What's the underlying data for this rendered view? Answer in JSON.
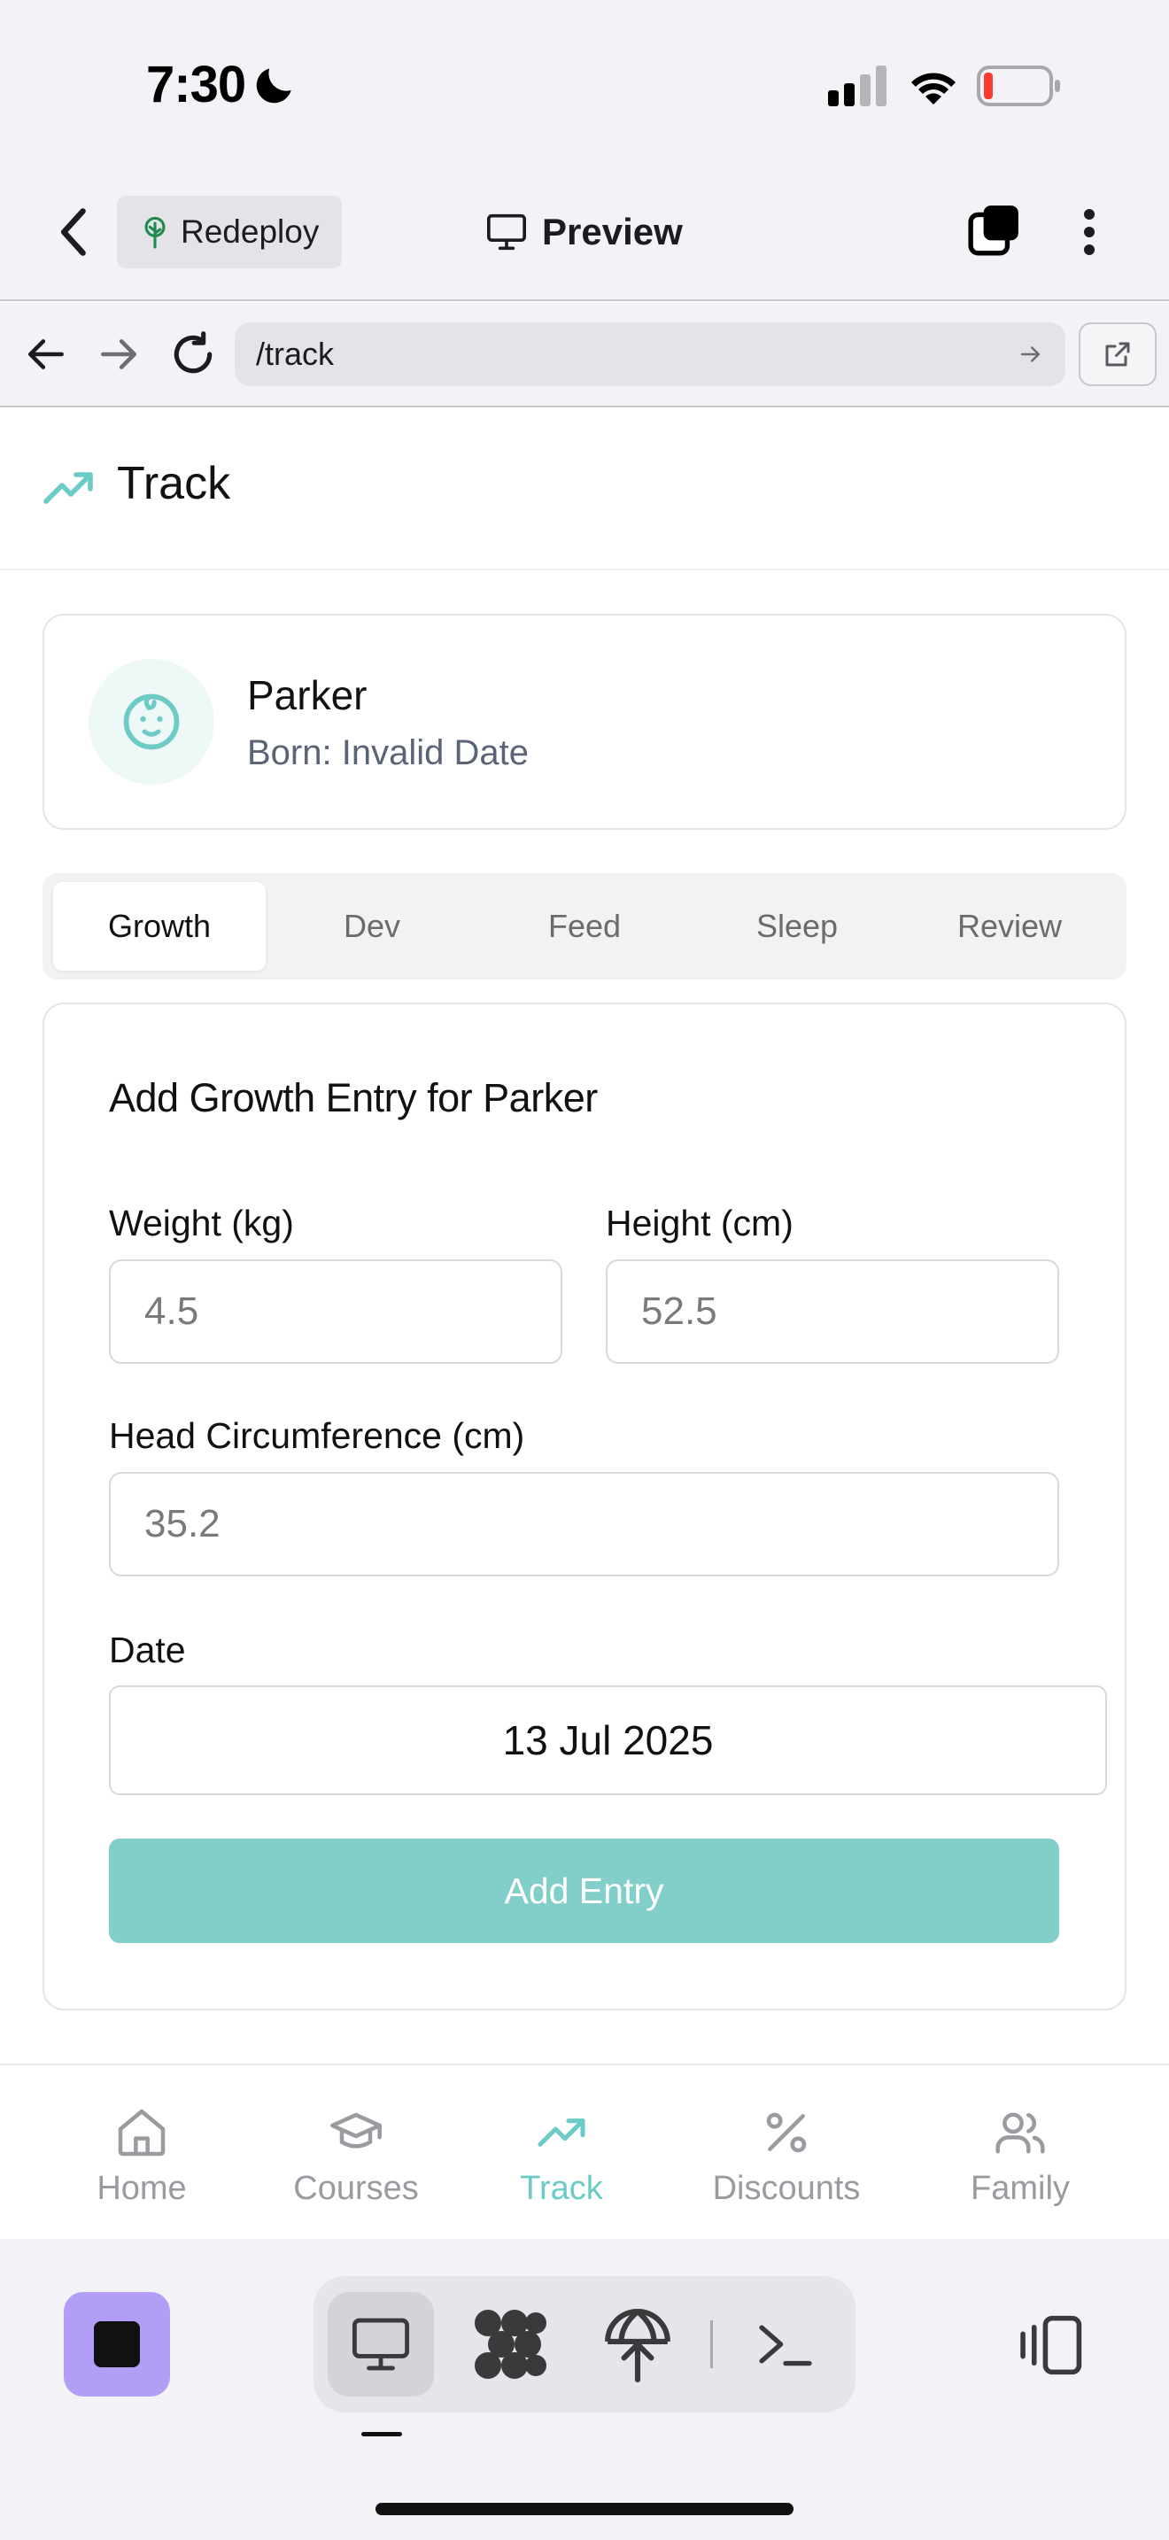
{
  "status_bar": {
    "time": "7:30"
  },
  "app_bar": {
    "redeploy_label": "Redeploy",
    "preview_label": "Preview"
  },
  "url_bar": {
    "url": "/track"
  },
  "page": {
    "title": "Track"
  },
  "child": {
    "name": "Parker",
    "born": "Born: Invalid Date"
  },
  "tabs": [
    {
      "label": "Growth",
      "active": true
    },
    {
      "label": "Dev",
      "active": false
    },
    {
      "label": "Feed",
      "active": false
    },
    {
      "label": "Sleep",
      "active": false
    },
    {
      "label": "Review",
      "active": false
    }
  ],
  "form": {
    "title": "Add Growth Entry for Parker",
    "weight_label": "Weight (kg)",
    "weight_placeholder": "4.5",
    "height_label": "Height (cm)",
    "height_placeholder": "52.5",
    "head_label": "Head Circumference (cm)",
    "head_placeholder": "35.2",
    "date_label": "Date",
    "date_value": "13 Jul 2025",
    "submit_label": "Add Entry"
  },
  "bottom_nav": [
    {
      "label": "Home",
      "icon": "home-icon",
      "active": false
    },
    {
      "label": "Courses",
      "icon": "graduation-cap-icon",
      "active": false
    },
    {
      "label": "Track",
      "icon": "trending-up-icon",
      "active": true
    },
    {
      "label": "Discounts",
      "icon": "percent-icon",
      "active": false
    },
    {
      "label": "Family",
      "icon": "users-icon",
      "active": false
    }
  ],
  "colors": {
    "accent": "#6ccbc4",
    "button": "#82cfc9",
    "stop_button": "#b39ef5",
    "battery_low": "#ff3b30"
  }
}
